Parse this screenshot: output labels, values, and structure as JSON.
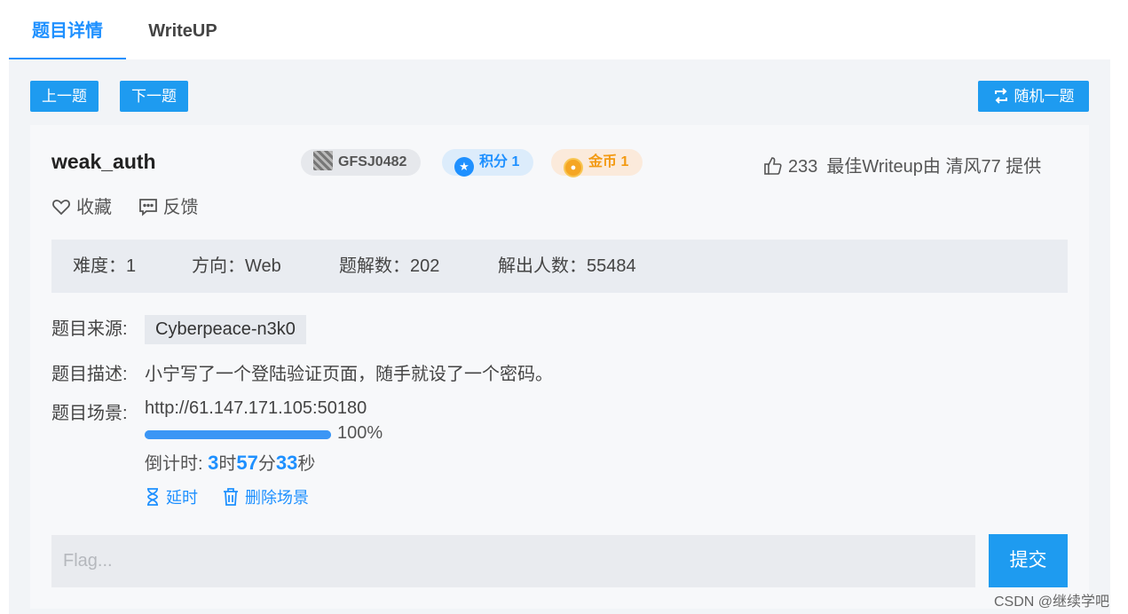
{
  "tabs": [
    {
      "label": "题目详情",
      "active": true
    },
    {
      "label": "WriteUP",
      "active": false
    }
  ],
  "nav": {
    "prev": "上一题",
    "next": "下一题",
    "random": "随机一题"
  },
  "challenge": {
    "title": "weak_auth",
    "id": "GFSJ0482",
    "score": "积分 1",
    "coins": "金币 1",
    "likes": "233",
    "best_writeup": "最佳Writeup由 清风77 提供",
    "favorite": "收藏",
    "feedback": "反馈"
  },
  "stats": {
    "difficulty": "难度：1",
    "direction": "方向：Web",
    "solves": "题解数：202",
    "solvers": "解出人数：55484"
  },
  "details": {
    "source_label": "题目来源:",
    "source": "Cyberpeace-n3k0",
    "desc_label": "题目描述:",
    "desc": "小宁写了一个登陆验证页面，随手就设了一个密码。",
    "scene_label": "题目场景:",
    "url": "http://61.147.171.105:50180",
    "progress": 1.0,
    "progress_text": "100%",
    "countdown_label": "倒计时: ",
    "hours": "3",
    "h_unit": "时",
    "minutes": "57",
    "m_unit": "分",
    "seconds": "33",
    "s_unit": "秒",
    "extend": "延时",
    "delete": "删除场景"
  },
  "flag": {
    "placeholder": "Flag...",
    "submit": "提交"
  },
  "watermark": "CSDN @继续学吧",
  "colors": {
    "accent": "#1e90ff",
    "button": "#1e9bf0",
    "coin": "#f39a12"
  }
}
